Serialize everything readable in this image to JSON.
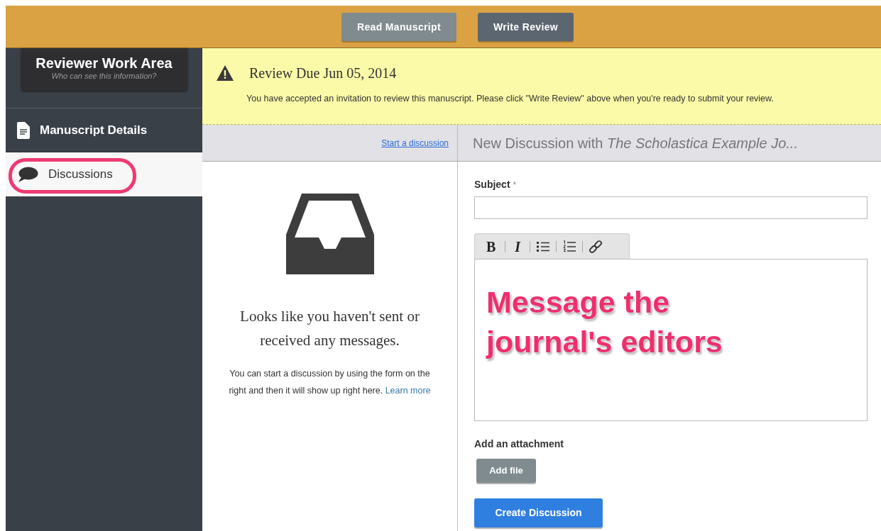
{
  "top_bar": {
    "buttons": [
      {
        "label": "Read Manuscript",
        "selected": false
      },
      {
        "label": "Write Review",
        "selected": true
      }
    ]
  },
  "sidebar": {
    "header": {
      "title": "Reviewer Work Area",
      "subtitle": "Who can see this information?"
    },
    "items": [
      {
        "label": "Manuscript Details",
        "kind": "document",
        "selected": false,
        "circled": false
      },
      {
        "label": "Discussions",
        "kind": "speech",
        "selected": true,
        "circled": true
      }
    ]
  },
  "notice": {
    "title": "Review Due Jun 05, 2014",
    "text": "You have accepted an invitation to review this manuscript. Please click \"Write Review\" above when you're ready to submit your review."
  },
  "discussions": {
    "link": "Start a discussion",
    "empty_title": "Looks like you haven't sent or received any messages.",
    "empty_text": "You can start a discussion by using the form on the right and then it will show up right here.",
    "learn_more": "Learn more"
  },
  "new_discussion": {
    "heading": "New Discussion with *The Scholastica Example Jo...*",
    "subject_label": "Subject",
    "required_mark": "*",
    "toolbar": [
      {
        "kind": "bold",
        "label": "B"
      },
      {
        "kind": "italic",
        "label": "I"
      },
      {
        "kind": "bullets"
      },
      {
        "kind": "numbers"
      },
      {
        "kind": "link"
      }
    ],
    "annotation": "Message the journal's editors",
    "attachment_label": "Add an attachment",
    "add_file": "Add file",
    "submit": "Create Discussion"
  }
}
